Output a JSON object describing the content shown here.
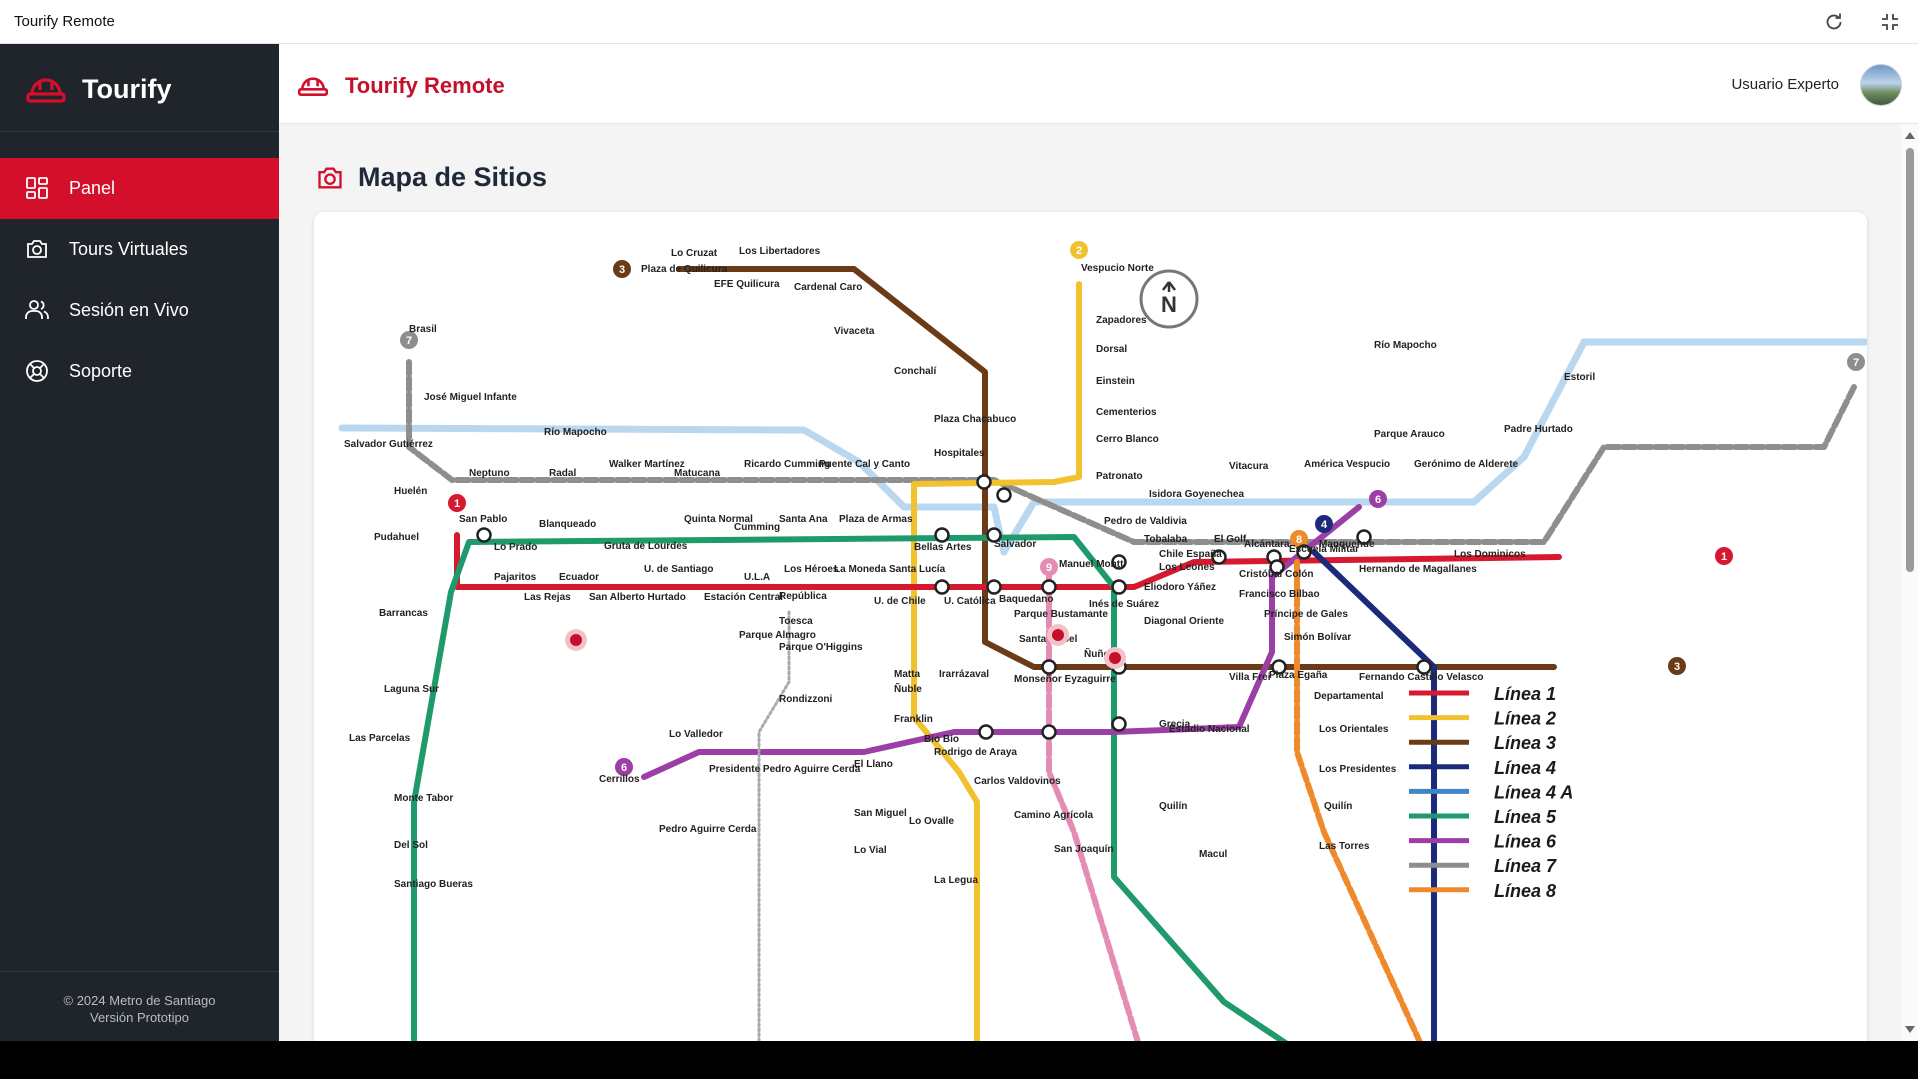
{
  "window": {
    "title": "Tourify Remote"
  },
  "sidebar": {
    "brand": "Tourify",
    "items": [
      {
        "label": "Panel",
        "icon": "grid-icon",
        "active": true
      },
      {
        "label": "Tours Virtuales",
        "icon": "camera-icon",
        "active": false
      },
      {
        "label": "Sesión en Vivo",
        "icon": "users-icon",
        "active": false
      },
      {
        "label": "Soporte",
        "icon": "lifebuoy-icon",
        "active": false
      }
    ],
    "footer": {
      "copyright": "© 2024 Metro de Santiago",
      "version": "Versión Prototipo"
    }
  },
  "header": {
    "title": "Tourify Remote",
    "user_name": "Usuario Experto"
  },
  "main": {
    "section_title": "Mapa de Sitios"
  },
  "map": {
    "compass": "N",
    "rivers": [
      "Río Mapocho",
      "Río Mapocho"
    ],
    "legend": [
      "Línea 1",
      "Línea 2",
      "Línea 3",
      "Línea 4",
      "Línea 4 A",
      "Línea 5",
      "Línea 6",
      "Línea 7",
      "Línea 8"
    ],
    "line_badges": [
      "1",
      "1",
      "2",
      "3",
      "3",
      "4",
      "6",
      "6",
      "7",
      "7",
      "8",
      "9"
    ],
    "stations": [
      "Plaza de Quilicura",
      "Lo Cruzat",
      "EFE Quilicura",
      "Los Libertadores",
      "Cardenal Caro",
      "Vivaceta",
      "Conchalí",
      "Plaza Chacabuco",
      "Hospitales",
      "Puente Cal y Canto",
      "Vespucio Norte",
      "Zapadores",
      "Dorsal",
      "Einstein",
      "Cementerios",
      "Cerro Blanco",
      "Patronato",
      "Brasil",
      "José Miguel Infante",
      "Salvador Gutiérrez",
      "Huelén",
      "Neptuno",
      "Radal",
      "Walker Martínez",
      "Matucana",
      "Ricardo Cumming",
      "San Pablo",
      "Pudahuel",
      "Blanqueado",
      "Lo Prado",
      "Gruta de Lourdes",
      "Quinta Normal",
      "Cumming",
      "Santa Ana",
      "Plaza de Armas",
      "Bellas Artes",
      "Pajaritos",
      "Las Rejas",
      "Ecuador",
      "San Alberto Hurtado",
      "U. de Santiago",
      "Estación Central",
      "U.L.A",
      "Los Héroes",
      "La Moneda",
      "Santa Lucía",
      "U. de Chile",
      "U. Católica",
      "Baquedano",
      "Salvador",
      "Manuel Montt",
      "Pedro de Valdivia",
      "Los Leones",
      "Tobalaba",
      "El Golf",
      "Alcántara",
      "Escuela Militar",
      "Manquehue",
      "Hernando de Magallanes",
      "Los Dominicos",
      "Vitacura",
      "Isidora Goyenechea",
      "América Vespucio",
      "Parque Arauco",
      "Gerónimo de Alderete",
      "Padre Hurtado",
      "Estoril",
      "República",
      "Toesca",
      "Parque O'Higgins",
      "Parque Almagro",
      "Matta",
      "Irarrázaval",
      "Monseñor Eyzaguirre",
      "Ñuñoa",
      "Chile España",
      "Villa Frei",
      "Plaza Egaña",
      "Fernando Castillo Velasco",
      "Parque Bustamante",
      "Santa Isabel",
      "Inés de Suárez",
      "Cristóbal Colón",
      "Francisco Bilbao",
      "Príncipe de Gales",
      "Simón Bolívar",
      "Eliodoro Yáñez",
      "Diagonal Oriente",
      "Rondizzoni",
      "Franklin",
      "Ñuble",
      "Bio Bío",
      "Estadio Nacional",
      "Grecia",
      "Barrancas",
      "Laguna Sur",
      "Las Parcelas",
      "Monte Tabor",
      "Del Sol",
      "Santiago Bueras",
      "Lo Valledor",
      "Presidente Pedro Aguirre Cerda",
      "Cerrillos",
      "Pedro Aguirre Cerda",
      "El Llano",
      "San Miguel",
      "Lo Vial",
      "Rodrigo de Araya",
      "Carlos Valdovinos",
      "Camino Agrícola",
      "San Joaquín",
      "Lo Ovalle",
      "La Legua",
      "Departamental",
      "Los Orientales",
      "Los Presidentes",
      "Quilín",
      "Las Torres",
      "Macul",
      "Quilín"
    ]
  },
  "colors": {
    "accent": "#d40f2b",
    "sidebar_bg": "#20242b",
    "l1": "#d7192f",
    "l2": "#f2c12e",
    "l3": "#6b3a17",
    "l4": "#1b2a7a",
    "l4a": "#3f86c7",
    "l5": "#1f9a6a",
    "l6": "#9b3ea5",
    "l7": "#8e8e8e",
    "l8": "#ef8a2c",
    "l9": "#e38db2",
    "river": "#b9d7ee"
  }
}
